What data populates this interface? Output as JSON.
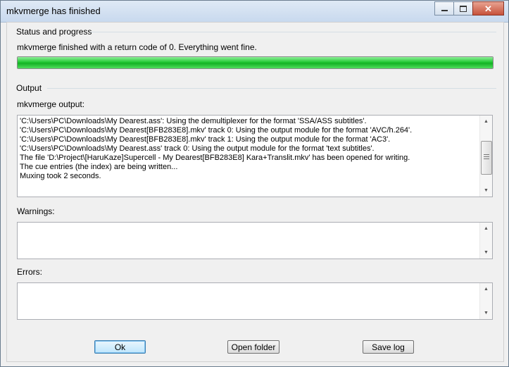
{
  "window": {
    "title": "mkvmerge has finished"
  },
  "status": {
    "group_title": "Status and progress",
    "message": "mkvmerge finished with a return code of 0. Everything went fine.",
    "progress": 1.0
  },
  "output": {
    "group_title": "Output",
    "label": "mkvmerge output:",
    "lines": [
      "'C:\\Users\\PC\\Downloads\\My Dearest.ass': Using the demultiplexer for the format 'SSA/ASS subtitles'.",
      "'C:\\Users\\PC\\Downloads\\My Dearest[BFB283E8].mkv' track 0: Using the output module for the format 'AVC/h.264'.",
      "'C:\\Users\\PC\\Downloads\\My Dearest[BFB283E8].mkv' track 1: Using the output module for the format 'AC3'.",
      "'C:\\Users\\PC\\Downloads\\My Dearest.ass' track 0: Using the output module for the format 'text subtitles'.",
      "The file 'D:\\Project\\[HaruKaze]Supercell - My Dearest[BFB283E8] Kara+Translit.mkv' has been opened for writing.",
      "The cue entries (the index) are being written...",
      "Muxing took 2 seconds."
    ]
  },
  "warnings": {
    "label": "Warnings:"
  },
  "errors": {
    "label": "Errors:"
  },
  "buttons": {
    "ok": "Ok",
    "open_folder": "Open folder",
    "save_log": "Save log"
  }
}
